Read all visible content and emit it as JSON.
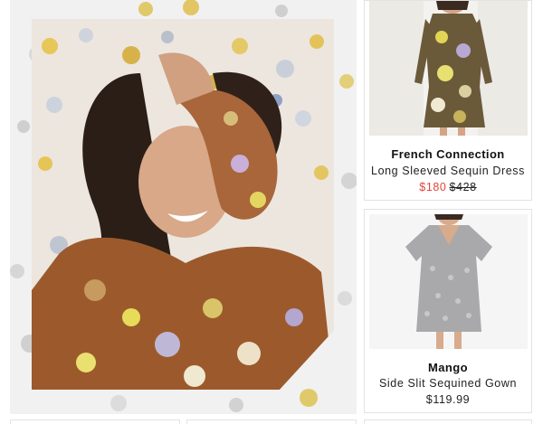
{
  "products": [
    {
      "brand": "French Connection",
      "name": "Long Sleeved Sequin Dress",
      "sale_price": "$180",
      "original_price": "$428",
      "image_icon": "sequin-dress-photo"
    },
    {
      "brand": "Mango",
      "name": "Side Slit Sequined Gown",
      "price": "$119.99",
      "image_icon": "silver-sequin-dress-photo"
    }
  ],
  "hero": {
    "image_icon": "model-in-sequins-photo"
  },
  "colors": {
    "sale": "#e2453b",
    "border": "#e3e3e3",
    "panel": "#f1f1f1"
  }
}
